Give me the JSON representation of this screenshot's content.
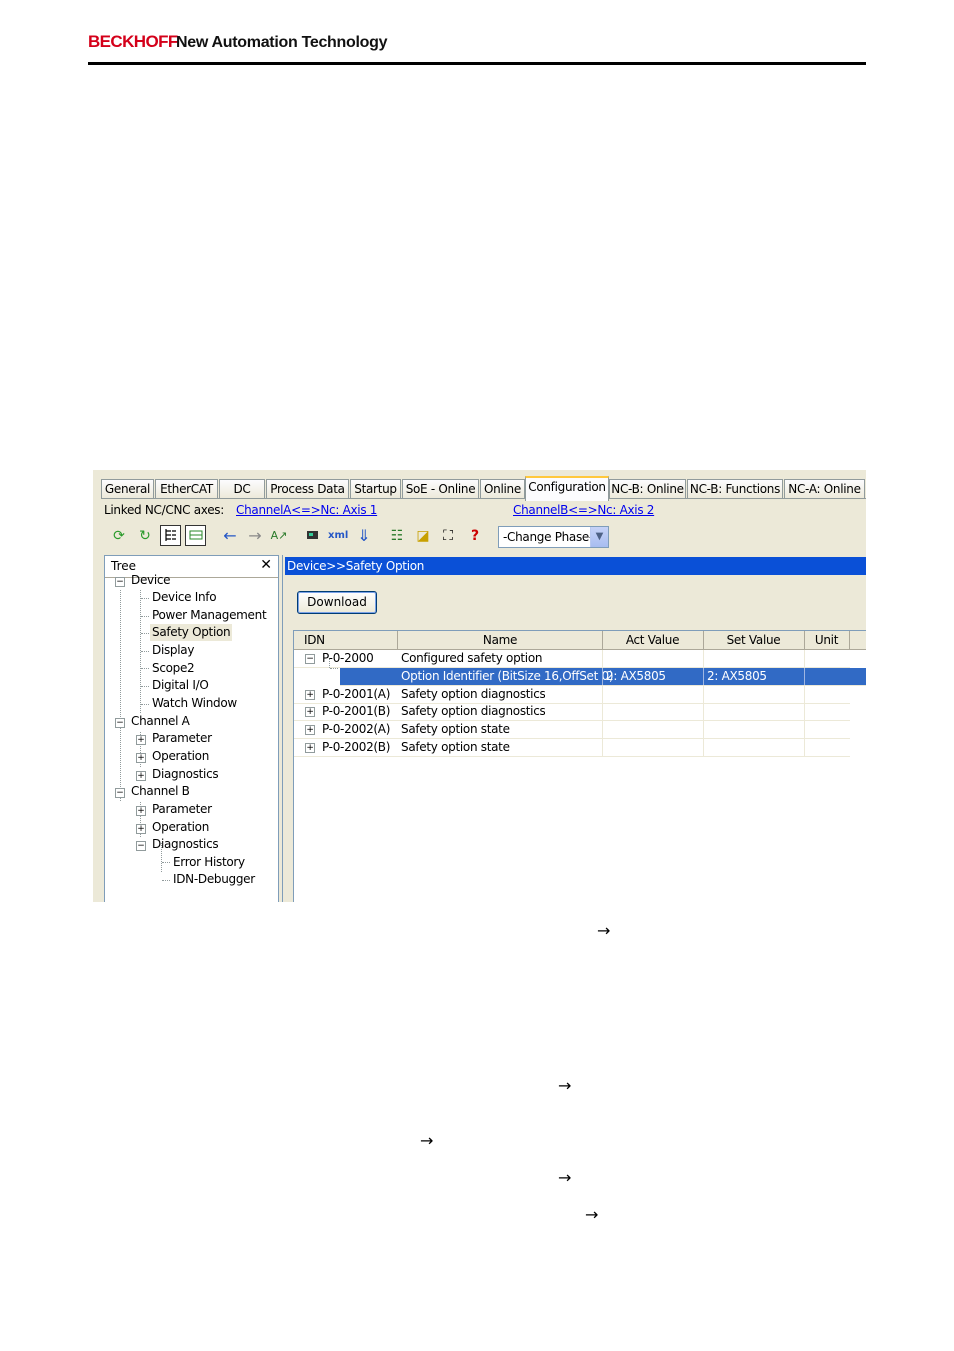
{
  "header": {
    "brand": "BECKHOFF",
    "tagline": "New Automation Technology"
  },
  "tabs": [
    "General",
    "EtherCAT",
    "DC",
    "Process Data",
    "Startup",
    "SoE - Online",
    "Online",
    "Configuration",
    "NC-B: Online",
    "NC-B: Functions",
    "NC-A: Online"
  ],
  "active_tab": "Configuration",
  "linked_axes": {
    "label": "Linked NC/CNC axes:",
    "channel_a": "ChannelA<=>Nc: Axis 1",
    "channel_b": "ChannelB<=>Nc: Axis 2"
  },
  "toolbar": {
    "phase_select": "-Change Phase-",
    "help_glyph": "?"
  },
  "tree": {
    "title": "Tree",
    "close_glyph": "✕",
    "items": [
      "Device",
      "Device Info",
      "Power Management",
      "Safety Option",
      "Display",
      "Scope2",
      "Digital I/O",
      "Watch Window",
      "Channel A",
      "Parameter",
      "Operation",
      "Diagnostics",
      "Channel B",
      "Parameter",
      "Operation",
      "Diagnostics",
      "Error History",
      "IDN-Debugger"
    ]
  },
  "panel": {
    "breadcrumb": "Device>>Safety Option",
    "download_label": "Download",
    "columns": [
      "IDN",
      "Name",
      "Act Value",
      "Set Value",
      "Unit"
    ],
    "rows": [
      {
        "idn": "P-0-2000",
        "name": "Configured safety option",
        "act": "",
        "set": ""
      },
      {
        "idn": "",
        "name": "Option Identifier (BitSize 16,OffSet 0)",
        "act": "2: AX5805",
        "set": "2: AX5805"
      },
      {
        "idn": "P-0-2001(A)",
        "name": "Safety option diagnostics",
        "act": "",
        "set": ""
      },
      {
        "idn": "P-0-2001(B)",
        "name": "Safety option diagnostics",
        "act": "",
        "set": ""
      },
      {
        "idn": "P-0-2002(A)",
        "name": "Safety option state",
        "act": "",
        "set": ""
      },
      {
        "idn": "P-0-2002(B)",
        "name": "Safety option state",
        "act": "",
        "set": ""
      }
    ]
  },
  "page_arrows": [
    "→",
    "→",
    "→",
    "→",
    "→"
  ]
}
